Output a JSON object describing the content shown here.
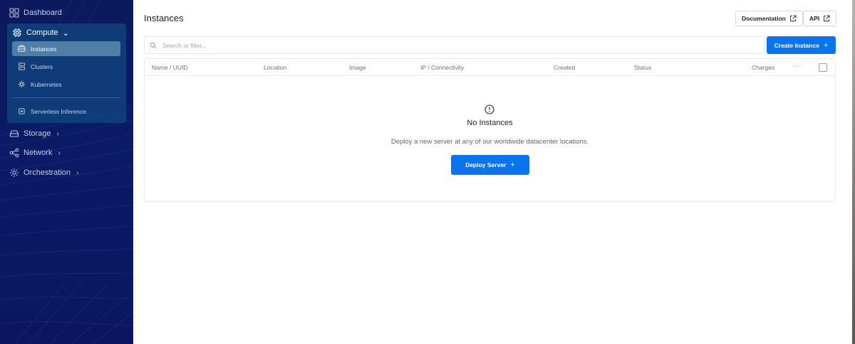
{
  "sidebar": {
    "dashboard": "Dashboard",
    "compute": "Compute",
    "compute_items": [
      "Instances",
      "Clusters",
      "Kubernetes",
      "Serverless Inference"
    ],
    "storage": "Storage",
    "network": "Network",
    "orchestration": "Orchestration",
    "chevron_right": "›",
    "chevron_down": "⌄"
  },
  "header": {
    "title": "Instances",
    "documentation_label": "Documentation",
    "api_label": "API"
  },
  "search": {
    "placeholder": "Search or filter..."
  },
  "actions": {
    "create_label": "Create Instance",
    "plus": "+"
  },
  "table": {
    "columns": [
      "Name / UUID",
      "Location",
      "Image",
      "IP / Connectivity",
      "Created",
      "Status",
      "Charges"
    ],
    "more": "···"
  },
  "empty_state": {
    "title": "No Instances",
    "description": "Deploy a new server at any of our worldwide datacenter locations.",
    "button": "Deploy Server"
  },
  "colors": {
    "accent": "#0a73f0",
    "sidebar_bg": "#0b1a66",
    "active_item": "#4f7ea6"
  }
}
